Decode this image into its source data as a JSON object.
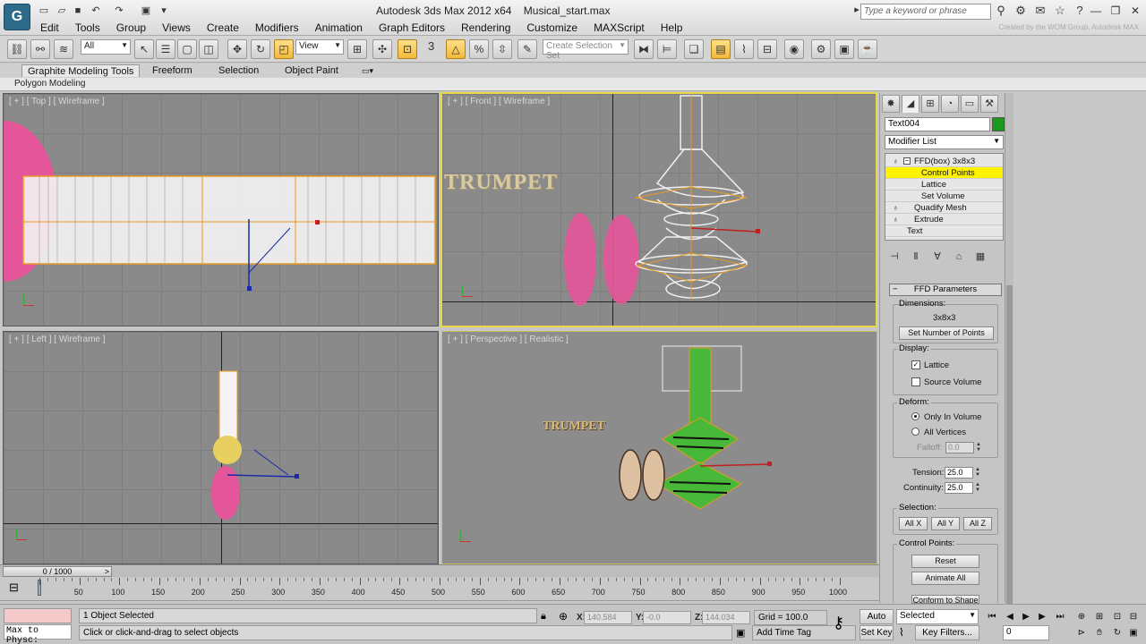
{
  "window": {
    "app_name": "Autodesk 3ds Max  2012 x64",
    "file_name": "Musical_start.max",
    "search_placeholder": "Type a keyword or phrase",
    "credit": "Created by the WOM Group, Autodesk MAX"
  },
  "menu": [
    "Edit",
    "Tools",
    "Group",
    "Views",
    "Create",
    "Modifiers",
    "Animation",
    "Graph Editors",
    "Rendering",
    "Customize",
    "MAXScript",
    "Help"
  ],
  "toolbar": {
    "selection_filter": "All",
    "ref_coord": "View",
    "named_selection_placeholder": "Create Selection Set",
    "snap_label": "3"
  },
  "ribbon": {
    "tabs": [
      "Graphite Modeling Tools",
      "Freeform",
      "Selection",
      "Object Paint"
    ],
    "active_tab": "Graphite Modeling Tools",
    "sub_label": "Polygon Modeling"
  },
  "viewports": {
    "top": {
      "label": "[ + ] [ Top ] [ Wireframe ]"
    },
    "front": {
      "label": "[ + ] [ Front ] [ Wireframe ]",
      "text_object": "TRUMPET"
    },
    "left": {
      "label": "[ + ] [ Left ] [ Wireframe ]"
    },
    "perspective": {
      "label": "[ + ] [ Perspective ] [ Realistic ]",
      "text_object": "TRUMPET"
    }
  },
  "command_panel": {
    "object_name": "Text004",
    "object_color": "#1a9a1a",
    "modifier_list_label": "Modifier List",
    "stack": [
      {
        "label": "FFD(box) 3x8x3",
        "level": 0,
        "expandable": true
      },
      {
        "label": "Control Points",
        "level": 1,
        "selected": true
      },
      {
        "label": "Lattice",
        "level": 1
      },
      {
        "label": "Set Volume",
        "level": 1
      },
      {
        "label": "Quadify Mesh",
        "level": 0
      },
      {
        "label": "Extrude",
        "level": 0
      },
      {
        "label": "Text",
        "level": 0
      }
    ],
    "rollout_title": "FFD Parameters",
    "dimensions_label": "Dimensions:",
    "dimensions_value": "3x8x3",
    "set_points_button": "Set Number of Points",
    "display_label": "Display:",
    "lattice_label": "Lattice",
    "lattice_checked": true,
    "source_volume_label": "Source Volume",
    "source_volume_checked": false,
    "deform_label": "Deform:",
    "only_in_volume_label": "Only In Volume",
    "all_vertices_label": "All Vertices",
    "falloff_label": "Falloff:",
    "falloff_value": "0.0",
    "tension_label": "Tension:",
    "tension_value": "25.0",
    "continuity_label": "Continuity:",
    "continuity_value": "25.0",
    "selection_label": "Selection:",
    "all_x": "All X",
    "all_y": "All Y",
    "all_z": "All Z",
    "control_points_label": "Control Points:",
    "reset_button": "Reset",
    "animate_all_button": "Animate All",
    "conform_button": "Conform to Shape"
  },
  "timeline": {
    "frame_display": "0 / 1000",
    "ticks": [
      "0",
      "50",
      "100",
      "150",
      "200",
      "250",
      "300",
      "350",
      "400",
      "450",
      "500",
      "550",
      "600",
      "650",
      "700",
      "750",
      "800",
      "850",
      "900",
      "950",
      "1000"
    ]
  },
  "status": {
    "maxscript_listener": "Max to Physc:",
    "selection_status": "1 Object Selected",
    "prompt": "Click or click-and-drag to select objects",
    "x_label": "X:",
    "x_value": "140.584",
    "y_label": "Y:",
    "y_value": "-0.0",
    "z_label": "Z:",
    "z_value": "144.034",
    "grid": "Grid = 100.0",
    "add_time_tag": "Add Time Tag",
    "auto_key": "Auto Key",
    "set_key": "Set Key",
    "selected_dropdown": "Selected",
    "key_filters": "Key Filters...",
    "current_frame": "0"
  }
}
